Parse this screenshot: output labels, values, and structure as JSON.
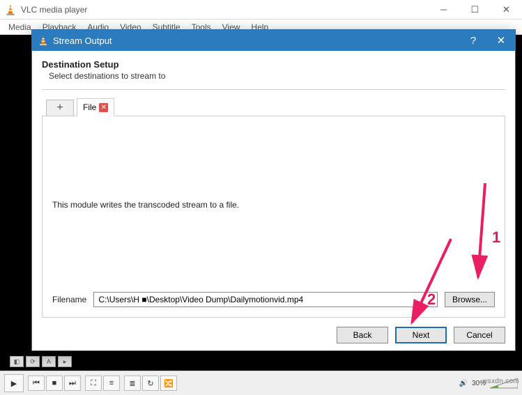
{
  "main_window": {
    "title": "VLC media player",
    "menu": [
      "Media",
      "Playback",
      "Audio",
      "Video",
      "Subtitle",
      "Tools",
      "View",
      "Help"
    ],
    "volume_percent": "30%"
  },
  "dialog": {
    "title": "Stream Output",
    "heading": "Destination Setup",
    "subheading": "Select destinations to stream to",
    "tab_label": "File",
    "description": "This module writes the transcoded stream to a file.",
    "filename_label": "Filename",
    "filename_value": "C:\\Users\\H ■\\Desktop\\Video Dump\\Dailymotionvid.mp4",
    "browse_label": "Browse...",
    "back_label": "Back",
    "next_label": "Next",
    "cancel_label": "Cancel"
  },
  "annotations": {
    "one": "1",
    "two": "2"
  },
  "watermark": "wsxdn.com"
}
